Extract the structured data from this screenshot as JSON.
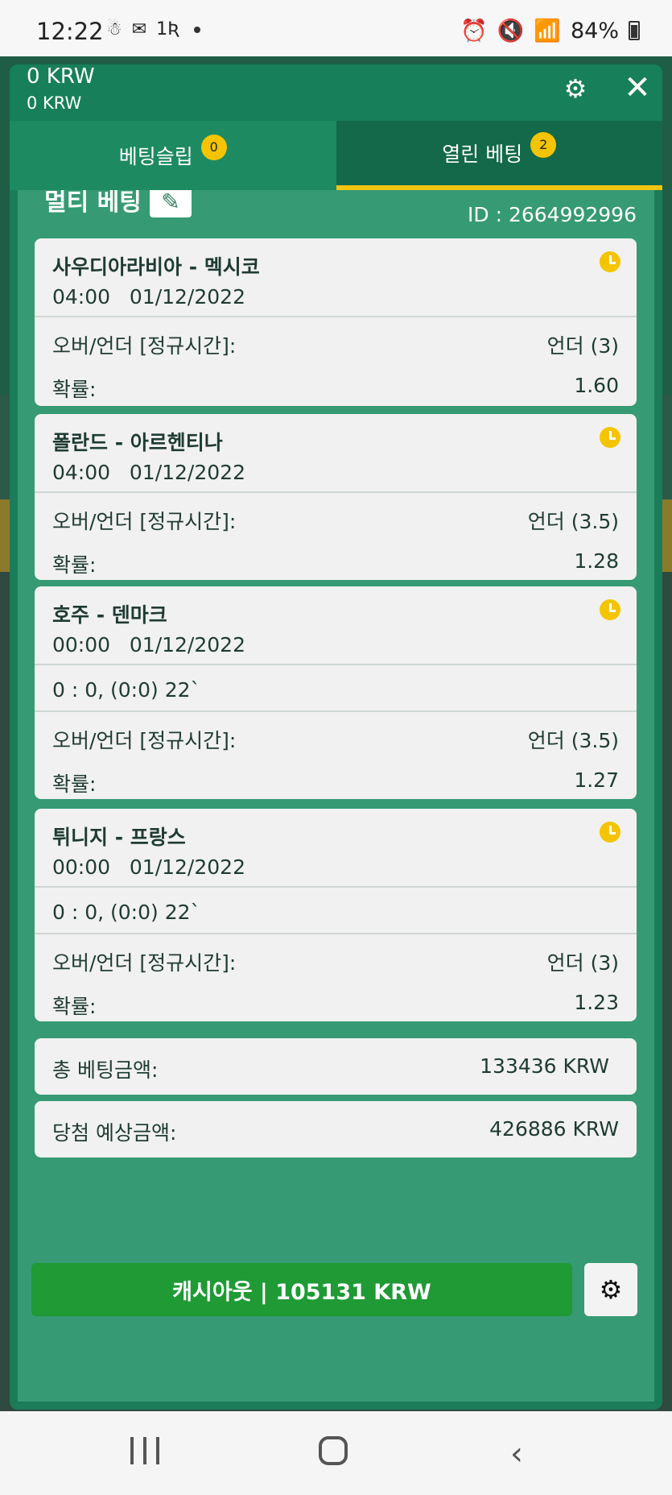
{
  "status_bar": {
    "time": "12:22",
    "left_icons": [
      "☃",
      "✉",
      "1Ʀ"
    ],
    "battery": "84%"
  },
  "header": {
    "balance_main": "0 KRW",
    "balance_sub": "0 KRW"
  },
  "tabs": [
    {
      "label": "베팅슬립",
      "count": "0"
    },
    {
      "label": "열린 베팅",
      "count": "2"
    }
  ],
  "bet": {
    "title": "멀티 베팅",
    "id_label": "ID :  2664992996",
    "events": [
      {
        "match": "사우디아라비아 - 멕시코",
        "time": "04:00",
        "date": "01/12/2022",
        "score": "",
        "market": "오버/언더 [정규시간]:",
        "selection": "언더 (3)",
        "odds_label": "확률:",
        "odds": "1.60"
      },
      {
        "match": "폴란드 - 아르헨티나",
        "time": "04:00",
        "date": "01/12/2022",
        "score": "",
        "market": "오버/언더 [정규시간]:",
        "selection": "언더 (3.5)",
        "odds_label": "확률:",
        "odds": "1.28"
      },
      {
        "match": "호주 - 덴마크",
        "time": "00:00",
        "date": "01/12/2022",
        "score": "0 : 0, (0:0) 22`",
        "market": "오버/언더 [정규시간]:",
        "selection": "언더 (3.5)",
        "odds_label": "확률:",
        "odds": "1.27"
      },
      {
        "match": "튀니지 - 프랑스",
        "time": "00:00",
        "date": "01/12/2022",
        "score": "0 : 0, (0:0) 22`",
        "market": "오버/언더 [정규시간]:",
        "selection": "언더 (3)",
        "odds_label": "확률:",
        "odds": "1.23"
      }
    ],
    "total_label": "총 베팅금액:",
    "total_value": "133436 KRW",
    "payout_label": "당첨 예상금액:",
    "payout_value": "426886 KRW",
    "cashout_label": "캐시아웃 | 105131 KRW"
  },
  "colors": {
    "panel": "#1a7c58",
    "content": "#369a74",
    "accent": "#f5c400",
    "cashout": "#1f9a35"
  }
}
